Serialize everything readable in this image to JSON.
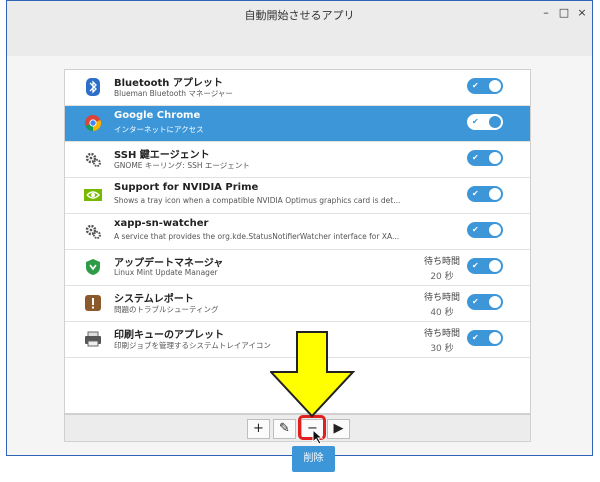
{
  "window": {
    "title": "自動開始させるアプリ",
    "min": "–",
    "max": "□",
    "close": "×"
  },
  "apps": [
    {
      "name": "Bluetooth アプレット",
      "desc": "Blueman Bluetooth マネージャー",
      "icon": "bluetooth-icon",
      "enabled": true,
      "selected": false
    },
    {
      "name": "Google Chrome",
      "desc": "インターネットにアクセス",
      "icon": "chrome-icon",
      "enabled": true,
      "selected": true
    },
    {
      "name": "SSH 鍵エージェント",
      "desc": "GNOME キーリング: SSH エージェント",
      "icon": "gear-icon",
      "enabled": true,
      "selected": false
    },
    {
      "name": "Support for NVIDIA Prime",
      "desc": "Shows a tray icon when a compatible NVIDIA Optimus graphics card is det...",
      "icon": "nvidia-icon",
      "enabled": true,
      "selected": false
    },
    {
      "name": "xapp-sn-watcher",
      "desc": "A service that provides the org.kde.StatusNotifierWatcher interface for XA...",
      "icon": "gear-icon",
      "enabled": true,
      "selected": false
    },
    {
      "name": "アップデートマネージャ",
      "desc": "Linux Mint Update Manager",
      "icon": "shield-icon",
      "enabled": true,
      "selected": false,
      "delay_label": "待ち時間",
      "delay": "20 秒"
    },
    {
      "name": "システムレポート",
      "desc": "問題のトラブルシューティング",
      "icon": "report-icon",
      "enabled": true,
      "selected": false,
      "delay_label": "待ち時間",
      "delay": "40 秒"
    },
    {
      "name": "印刷キューのアプレット",
      "desc": "印刷ジョブを管理するシステムトレイアイコン",
      "icon": "printer-icon",
      "enabled": true,
      "selected": false,
      "delay_label": "待ち時間",
      "delay": "30 秒"
    }
  ],
  "toolbar": {
    "add": "+",
    "edit": "✎",
    "remove": "−",
    "run": "▶"
  },
  "tooltip": "削除",
  "colors": {
    "accent": "#3c96d8",
    "highlight": "#e0201e",
    "arrow": "#ffff00"
  }
}
